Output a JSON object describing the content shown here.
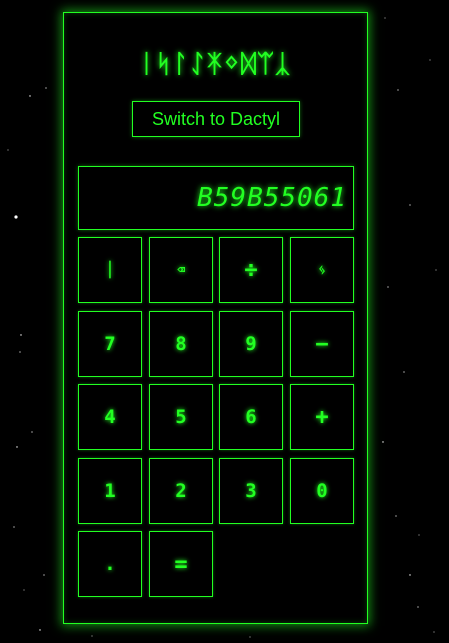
{
  "app": {
    "title": "ᛁᛋᛚᛇᛡᛜᛞᛠᛣ",
    "switch_label": "Switch to Dactyl",
    "display_value": "B59B55061",
    "accent_color": "#22ff22"
  },
  "keys": {
    "mode": "ᛁ",
    "backspace": "⌫",
    "divide": "÷",
    "multiply": "ᛃ",
    "k7": "7",
    "k8": "8",
    "k9": "9",
    "minus": "−",
    "k4": "4",
    "k5": "5",
    "k6": "6",
    "plus": "+",
    "k1": "1",
    "k2": "2",
    "k3": "3",
    "k0": "0",
    "dot": ".",
    "equals": "="
  }
}
